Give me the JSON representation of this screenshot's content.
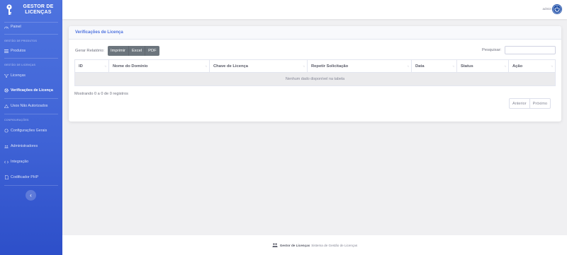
{
  "brand": {
    "line1": "GESTOR DE",
    "line2": "LICENÇAS"
  },
  "sidebar": {
    "panel": "Painel",
    "heading_products": "GESTÃO DE PRODUTOS",
    "products": "Produtos",
    "heading_licenses": "GESTÃO DE LICENÇAS",
    "licenses": "Licenças",
    "license_checks": "Verificações de Licença",
    "unauthorized": "Usos Não Autorizados",
    "heading_config": "CONFIGURAÇÕES",
    "general_settings": "Configurações Gerais",
    "admins": "Administradores",
    "integration": "Integração",
    "php_encoder": "Codificador PHP",
    "toggle_icon": "‹"
  },
  "topbar": {
    "user": "admin"
  },
  "card": {
    "title": "Verificações de Licença",
    "report_label": "Gerar Relatório:",
    "buttons": {
      "print": "Imprimir",
      "excel": "Excel",
      "pdf": "PDF"
    },
    "search_label": "Pesquisar:",
    "search_value": ""
  },
  "table": {
    "columns": [
      "ID",
      "Nome do Domínio",
      "Chave de Licença",
      "Repetir Solicitação",
      "Data",
      "Status",
      "Ação"
    ],
    "empty_message": "Nenhum dado disponível na tabela"
  },
  "info": "Mostrando 0 a 0 de 0 registros",
  "pagination": {
    "prev": "Anterior",
    "next": "Próximo"
  },
  "footer": {
    "brand": "Gestor de Licenças",
    "text": "Sistema de Gestão de Licenças"
  },
  "colors": {
    "primary": "#4e73df",
    "secondary_button": "#6c757d"
  }
}
